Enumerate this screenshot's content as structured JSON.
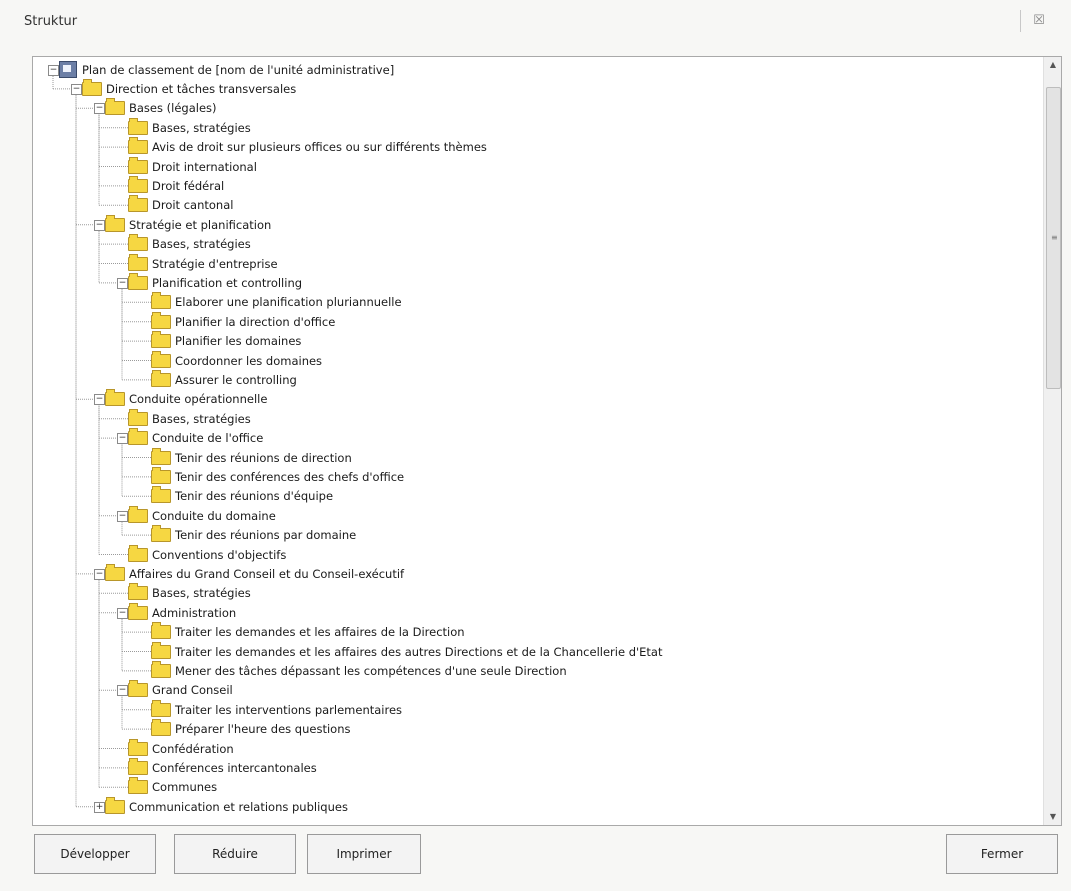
{
  "window": {
    "title": "Struktur",
    "close_label": "☒"
  },
  "tree": [
    {
      "label": "Plan de classement de [nom de l'unité administrative]",
      "level": 0,
      "expanded": true,
      "root": true
    },
    {
      "label": "Direction et tâches transversales",
      "level": 1,
      "expanded": true
    },
    {
      "label": "Bases (légales)",
      "level": 2,
      "expanded": true
    },
    {
      "label": "Bases, stratégies",
      "level": 3
    },
    {
      "label": "Avis de droit sur plusieurs offices ou sur différents thèmes",
      "level": 3
    },
    {
      "label": "Droit international",
      "level": 3
    },
    {
      "label": "Droit fédéral",
      "level": 3
    },
    {
      "label": "Droit cantonal",
      "level": 3
    },
    {
      "label": "Stratégie et planification",
      "level": 2,
      "expanded": true
    },
    {
      "label": "Bases, stratégies",
      "level": 3
    },
    {
      "label": "Stratégie d'entreprise",
      "level": 3
    },
    {
      "label": "Planification et controlling",
      "level": 3,
      "expanded": true
    },
    {
      "label": "Elaborer une planification pluriannuelle",
      "level": 4
    },
    {
      "label": "Planifier la direction d'office",
      "level": 4
    },
    {
      "label": "Planifier les domaines",
      "level": 4
    },
    {
      "label": "Coordonner les domaines",
      "level": 4
    },
    {
      "label": "Assurer le controlling",
      "level": 4
    },
    {
      "label": "Conduite opérationnelle",
      "level": 2,
      "expanded": true
    },
    {
      "label": "Bases, stratégies",
      "level": 3
    },
    {
      "label": "Conduite de l'office",
      "level": 3,
      "expanded": true
    },
    {
      "label": "Tenir des réunions de direction",
      "level": 4
    },
    {
      "label": "Tenir des conférences des chefs d'office",
      "level": 4
    },
    {
      "label": "Tenir des réunions d'équipe",
      "level": 4
    },
    {
      "label": "Conduite du domaine",
      "level": 3,
      "expanded": true
    },
    {
      "label": "Tenir des réunions par domaine",
      "level": 4
    },
    {
      "label": "Conventions d'objectifs",
      "level": 3
    },
    {
      "label": "Affaires du Grand Conseil et du Conseil-exécutif",
      "level": 2,
      "expanded": true
    },
    {
      "label": "Bases, stratégies",
      "level": 3
    },
    {
      "label": "Administration",
      "level": 3,
      "expanded": true
    },
    {
      "label": "Traiter les demandes et les affaires de la Direction",
      "level": 4
    },
    {
      "label": "Traiter les demandes et les affaires des autres Directions et de la Chancellerie d'Etat",
      "level": 4
    },
    {
      "label": "Mener des tâches dépassant les compétences d'une seule Direction",
      "level": 4
    },
    {
      "label": "Grand Conseil",
      "level": 3,
      "expanded": true
    },
    {
      "label": "Traiter les interventions parlementaires",
      "level": 4
    },
    {
      "label": "Préparer l'heure des questions",
      "level": 4
    },
    {
      "label": "Confédération",
      "level": 3
    },
    {
      "label": "Conférences intercantonales",
      "level": 3
    },
    {
      "label": "Communes",
      "level": 3
    },
    {
      "label": "Communication et relations publiques",
      "level": 2,
      "expanded": false
    }
  ],
  "buttons": {
    "expand": "Développer",
    "collapse": "Réduire",
    "print": "Imprimer",
    "close": "Fermer"
  },
  "icons": {
    "folder": "folder-icon",
    "root": "plan-icon",
    "expander": "minus-box-icon"
  }
}
